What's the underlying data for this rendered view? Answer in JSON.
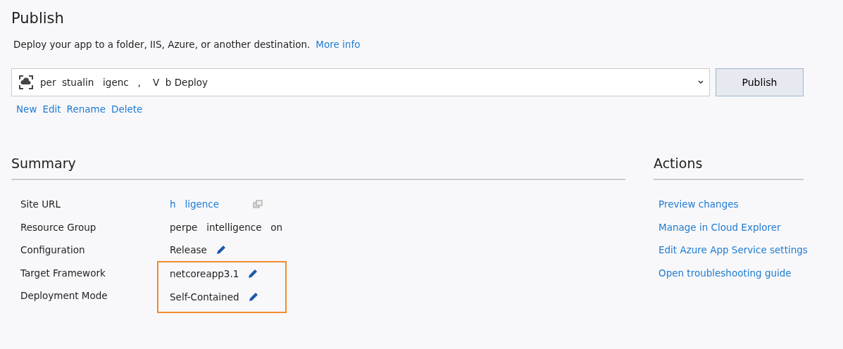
{
  "title": "Publish",
  "description": "Deploy your app to a folder, IIS, Azure, or another destination.",
  "more_info_link": "More info",
  "profile_dropdown": {
    "value": "per  stualin   igenc   ,    V  b Deploy"
  },
  "publish_button": "Publish",
  "profile_actions": [
    "New",
    "Edit",
    "Rename",
    "Delete"
  ],
  "summary": {
    "heading": "Summary",
    "rows": [
      {
        "label": "Site URL",
        "value": "h   ligence",
        "kind": "link",
        "editable": false,
        "highlighted": false
      },
      {
        "label": "Resource Group",
        "value": "perpe   intelligence   on",
        "kind": "text",
        "editable": false,
        "highlighted": false
      },
      {
        "label": "Configuration",
        "value": "Release",
        "kind": "text",
        "editable": true,
        "highlighted": false
      },
      {
        "label": "Target Framework",
        "value": "netcoreapp3.1",
        "kind": "text",
        "editable": true,
        "highlighted": true
      },
      {
        "label": "Deployment Mode",
        "value": "Self-Contained",
        "kind": "text",
        "editable": true,
        "highlighted": true
      }
    ]
  },
  "actions": {
    "heading": "Actions",
    "links": [
      "Preview changes",
      "Manage in Cloud Explorer",
      "Edit Azure App Service settings",
      "Open troubleshooting guide"
    ]
  }
}
